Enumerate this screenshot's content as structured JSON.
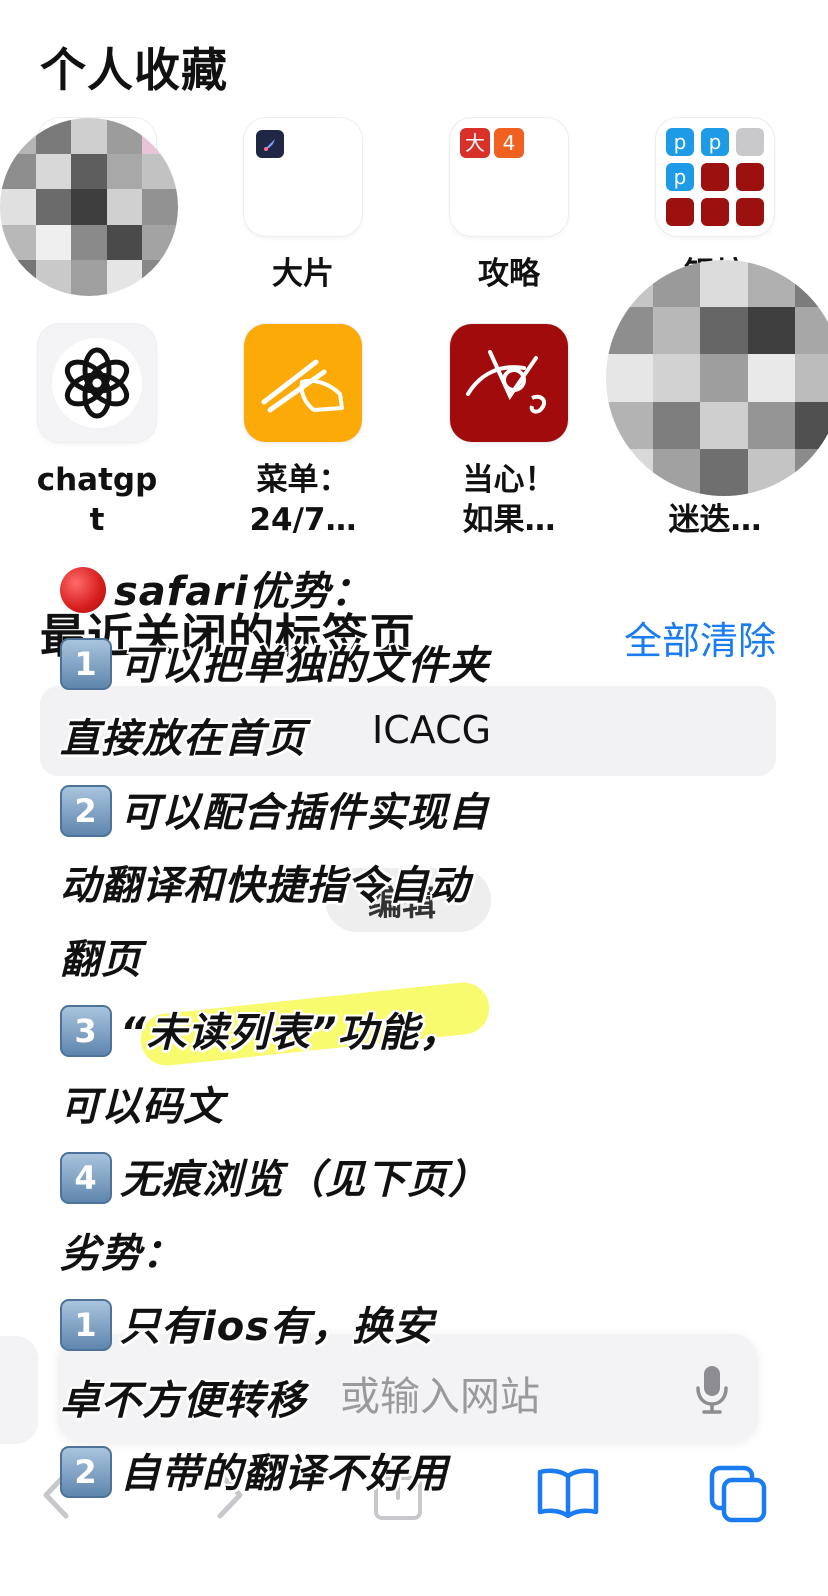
{
  "favorites": {
    "title": "个人收藏",
    "row1": [
      {
        "label": ""
      },
      {
        "label": "大片"
      },
      {
        "label": "攻略",
        "badge_left": "大",
        "badge_right": "4"
      },
      {
        "label": "银坊"
      }
    ],
    "row2": [
      {
        "label_lines": [
          "chatgp",
          "t"
        ],
        "icon": "openai-logo-icon"
      },
      {
        "label_lines": [
          "菜单：",
          "24/7…"
        ],
        "icon": "chopsticks-icon"
      },
      {
        "label_lines": [
          "当心！",
          "如果…"
        ],
        "icon": "red-brand-icon"
      },
      {
        "label_lines": [
          "【特",
          "迷迭…"
        ],
        "icon": "blurred-icon"
      }
    ]
  },
  "recent": {
    "title": "最近关闭的标签页",
    "clear_all": "全部清除",
    "tab_label": "ICACG",
    "edit_label": "编辑"
  },
  "address_bar": {
    "placeholder": "或输入网站"
  },
  "toolbar": {
    "icons": [
      "back-chevron-icon",
      "forward-chevron-icon",
      "share-icon",
      "bookmarks-icon",
      "tabs-icon"
    ]
  },
  "overlay": {
    "lines": [
      "safari优势：",
      "可以把单独的文件夹",
      "直接放在首页",
      "可以配合插件实现自",
      "动翻译和快捷指令自动",
      "翻页",
      "“未读列表”功能，",
      "可以码文",
      "无痕浏览（见下页）",
      "劣势：",
      "只有ios有，换安",
      "卓不方便转移",
      "自带的翻译不好用"
    ],
    "keycaps": [
      "1",
      "2",
      "3",
      "4",
      "1",
      "2"
    ]
  }
}
